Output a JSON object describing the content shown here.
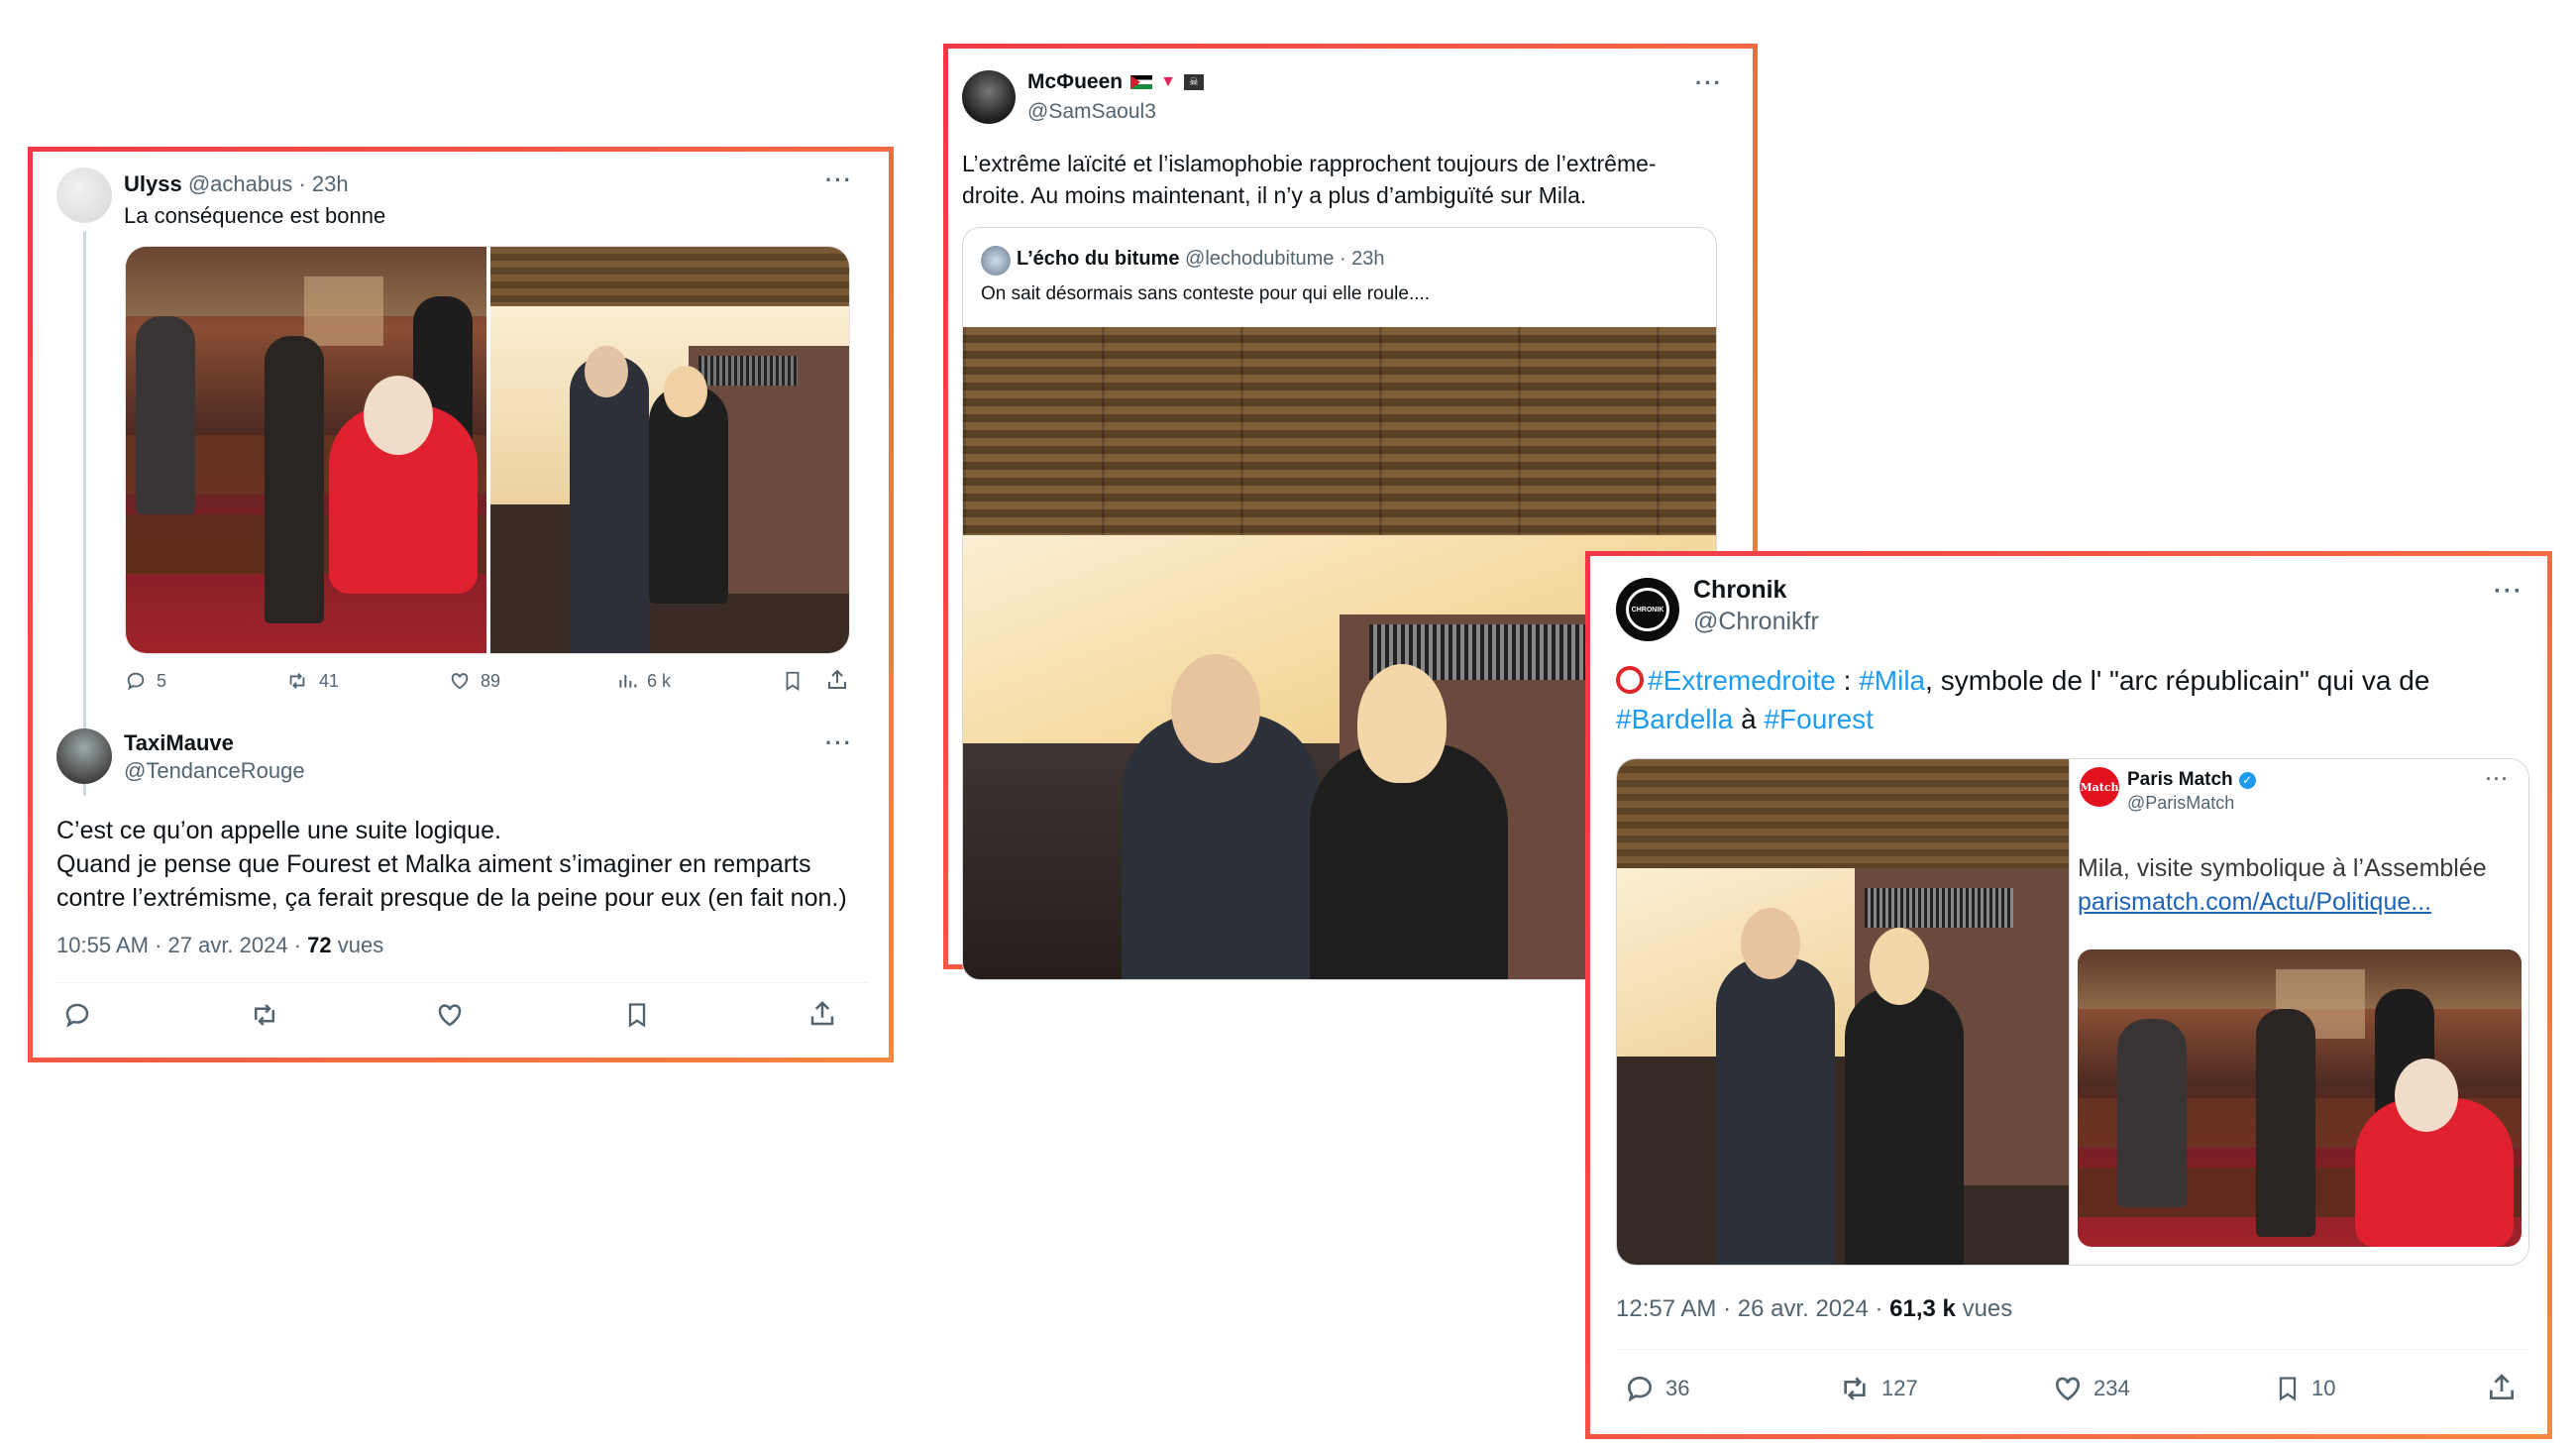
{
  "tweet1": {
    "parent": {
      "name": "Ulyss",
      "handle": "@achabus · 23h",
      "text": "La conséquence est bonne",
      "stats": {
        "replies": "5",
        "retweets": "41",
        "likes": "89",
        "views": "6 k"
      }
    },
    "reply": {
      "name": "TaxiMauve",
      "handle": "@TendanceRouge",
      "lines": [
        "C’est ce qu’on appelle une suite logique.",
        "Quand je pense que Fourest et Malka aiment s’imaginer en remparts",
        "contre l’extrémisme, ça ferait presque de la peine pour eux (en fait non.)"
      ],
      "time": "10:55 AM · 27 avr. 2024 · ",
      "views_count": "72",
      "views_label": " vues"
    }
  },
  "tweet2": {
    "name": "McФueen",
    "handle": "@SamSaoul3",
    "lines": [
      "L’extrême laïcité et l’islamophobie rapprochent toujours de l’extrême-",
      "droite. Au moins maintenant, il n’y a plus d’ambiguïté sur Mila."
    ],
    "quote": {
      "name": "L’écho du bitume",
      "handle": "@lechodubitume · 23h",
      "text": "On sait désormais sans conteste pour qui elle roule...."
    }
  },
  "tweet3": {
    "avatar_text": "CHRONIK",
    "name": "Chronik",
    "handle": "@Chronikfr",
    "text": {
      "tag1": "#Extremedroite",
      "sep1": " : ",
      "tag2": "#Mila",
      "mid": ", symbole de l' \"arc républicain\" qui va de",
      "tag3": "#Bardella",
      "and": " à ",
      "tag4": "#Fourest"
    },
    "card": {
      "logo": "Match",
      "name": "Paris Match",
      "handle": "@ParisMatch",
      "title": "Mila, visite symbolique à l’Assemblée",
      "link": "parismatch.com/Actu/Politique..."
    },
    "time": "12:57 AM · 26 avr. 2024 · ",
    "views_count": "61,3 k",
    "views_label": " vues",
    "stats": {
      "replies": "36",
      "retweets": "127",
      "likes": "234",
      "bookmarks": "10"
    }
  },
  "colors": {
    "frame_start": "#ee3a47",
    "frame_end": "#f8873f",
    "link": "#1d9bf0",
    "verified": "#1d9bf0"
  }
}
